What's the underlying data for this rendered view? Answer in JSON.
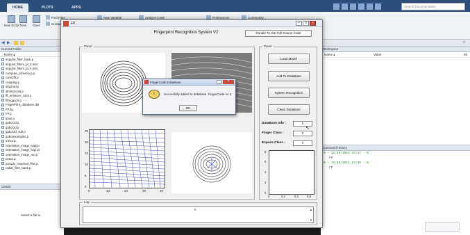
{
  "matlab": {
    "tabs": [
      "HOME",
      "PLOTS",
      "APPS"
    ],
    "search_placeholder": "Search Documentation",
    "toolbar": [
      {
        "label": "New Script",
        "icon": "new-script-icon"
      },
      {
        "label": "New",
        "icon": "new-icon"
      },
      {
        "label": "Open",
        "icon": "open-icon"
      },
      {
        "label": "Find Files",
        "icon": "find-files-icon"
      },
      {
        "label": "Compare",
        "icon": "compare-icon"
      },
      {
        "label": "New Variable",
        "icon": "new-variable-icon"
      },
      {
        "label": "Analyze Code",
        "icon": "analyze-code-icon"
      },
      {
        "label": "Preferences",
        "icon": "preferences-icon"
      },
      {
        "label": "Community",
        "icon": "community-icon"
      }
    ],
    "current_folder": {
      "title": "Current Folder",
      "column": "Name ▴",
      "files": [
        "angular_filter_bank.p",
        "angular_filters_pi_2.mat",
        "angular_filters_pi_4.mat",
        "compute_coherence.p",
        "conv2fft.p",
        "cropping.p",
        "deg2rad.p",
        "diminoroots.p",
        "fft_enhance_cubs.p",
        "fftreggcorr.p",
        "FingerPrint_database.dat",
        "FP.fig",
        "FP.p",
        "fpnei.p",
        "gabor1d.p",
        "gabor2d.p",
        "gabor2d_sub.p",
        "gaborexamples.p",
        "mirror.p",
        "orientation_image_luigicp",
        "orientation_image_luigi.pt",
        "orientation_image_rao.p",
        "prova.p",
        "pseudo_matched_filter.p",
        "radial_filter_bank.p"
      ],
      "details_label": "Details",
      "details_text": "Select a file to"
    },
    "workspace": {
      "title": "Workspace",
      "col_name": "Name ▴",
      "col_value": "Value",
      "col_min": "Mi"
    },
    "command_history": {
      "title": "Command History",
      "entries": [
        {
          "text": "%-- 12/10/2014 20:47 --%",
          "type": "date"
        },
        {
          "text": "FP",
          "type": "cmd"
        },
        {
          "text": "%-- 12/10/2014 23:40 --%",
          "type": "date"
        },
        {
          "text": "FP",
          "type": "cmd"
        }
      ]
    }
  },
  "app": {
    "window_title": "FP",
    "title": "Fingerprint Recognition System V2",
    "donate_label": "Donate To Get Full Source Code",
    "left_panel_label": "Panel",
    "right_panel_label": "Panel",
    "buttons": {
      "load_model": "Load Model",
      "add_db": "Add To DataBase",
      "system_recognition": "System Recognition",
      "clean_db": "Clean DataBase"
    },
    "fields": {
      "db_info_label": "DataBase Info :",
      "db_info_value": "3",
      "finger_class_label": "Finger Class :",
      "finger_class_value": "0",
      "espace_class_label": "Espace Class :",
      "espace_class_value": "0"
    },
    "log_label": "Log",
    "log_value": "0",
    "plot_xticks": [
      "0",
      "10",
      "20",
      "30",
      "40"
    ],
    "plot_yticks": [
      "0",
      "5",
      "10",
      "15",
      "20",
      "25"
    ],
    "mini_xticks": [
      "0",
      "0.2",
      "0.4",
      "0.6"
    ],
    "mini_yticks": [
      "0",
      "2",
      "4",
      "6",
      "8"
    ]
  },
  "dialog": {
    "title": "FingerCode DataBase",
    "message": "Succesfully added to database. FingerCode no 3",
    "ok_label": "OK"
  }
}
